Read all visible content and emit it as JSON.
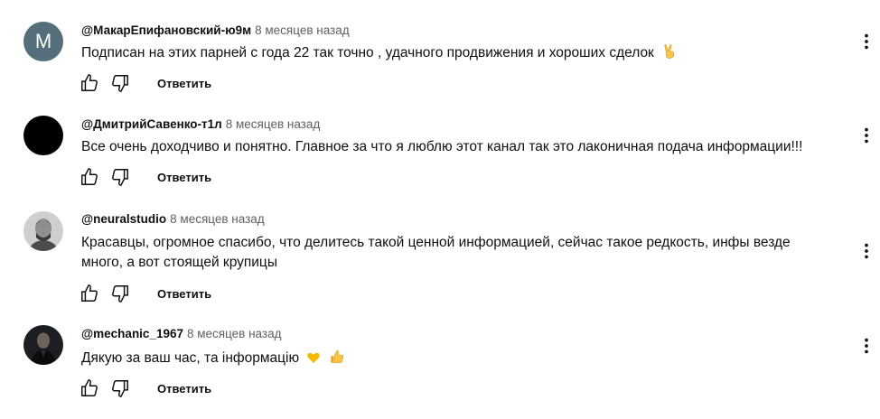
{
  "actions": {
    "like_icon": "thumb-up-icon",
    "dislike_icon": "thumb-down-icon",
    "more_icon": "more-vert-icon"
  },
  "comments": [
    {
      "avatar_letter": "M",
      "avatar_color": "#546e7a",
      "author": "@МакарЕпифановский-ю9м",
      "time": "8 месяцев назад",
      "text": "Подписан на этих парней с года 22 так точно , удачного продвижения и хороших сделок",
      "emoji": "victory-hand",
      "reply_label": "Ответить"
    },
    {
      "avatar_color": "#000000",
      "author": "@ДмитрийСавенко-т1л",
      "time": "8 месяцев назад",
      "text": "Все очень доходчиво и понятно. Главное за что я люблю этот канал так это лаконичная подача информации!!!",
      "reply_label": "Ответить"
    },
    {
      "author": "@neuralstudio",
      "time": "8 месяцев назад",
      "text_line1": "Красавцы, огромное спасибо, что делитесь такой ценной информацией, сейчас такое редкость, инфы везде",
      "text_line2": "много, а вот стоящей крупицы",
      "reply_label": "Ответить"
    },
    {
      "author": "@mechanic_1967",
      "time": "8 месяцев назад",
      "text": "Дякую за ваш час, та інформацію",
      "emoji": "yellow-heart thumbs-up",
      "reply_label": "Ответить"
    }
  ]
}
